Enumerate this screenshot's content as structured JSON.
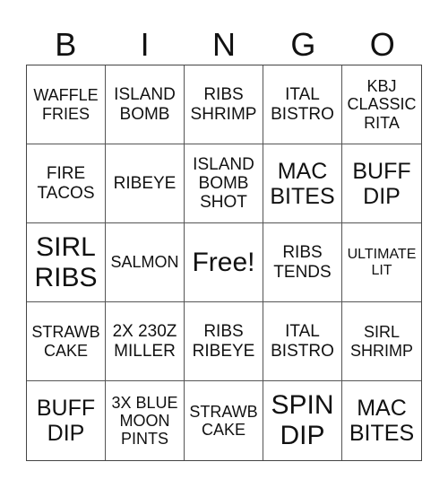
{
  "header": {
    "letters": [
      "B",
      "I",
      "N",
      "G",
      "O"
    ]
  },
  "card": {
    "cells": [
      {
        "text": "WAFFLE FRIES",
        "size": "s17"
      },
      {
        "text": "ISLAND BOMB",
        "size": "s19"
      },
      {
        "text": "RIBS SHRIMP",
        "size": "s19"
      },
      {
        "text": "ITAL BISTRO",
        "size": "s19"
      },
      {
        "text": "KBJ CLASSIC RITA",
        "size": "s17"
      },
      {
        "text": "FIRE TACOS",
        "size": "s19"
      },
      {
        "text": "RIBEYE",
        "size": "s19"
      },
      {
        "text": "ISLAND BOMB SHOT",
        "size": "s19"
      },
      {
        "text": "MAC BITES",
        "size": "s24"
      },
      {
        "text": "BUFF DIP",
        "size": "s24"
      },
      {
        "text": "SIRL RIBS",
        "size": "s29"
      },
      {
        "text": "SALMON",
        "size": "s17"
      },
      {
        "text": "Free!",
        "size": "s29"
      },
      {
        "text": "RIBS TENDS",
        "size": "s19"
      },
      {
        "text": "ULTIMATE LIT",
        "size": "s14"
      },
      {
        "text": "STRAWB CAKE",
        "size": "s17"
      },
      {
        "text": "2X 230Z MILLER",
        "size": "s19"
      },
      {
        "text": "RIBS RIBEYE",
        "size": "s19"
      },
      {
        "text": "ITAL BISTRO",
        "size": "s19"
      },
      {
        "text": "SIRL SHRIMP",
        "size": "s17"
      },
      {
        "text": "BUFF DIP",
        "size": "s24"
      },
      {
        "text": "3X BLUE MOON PINTS",
        "size": "s17"
      },
      {
        "text": "STRAWB CAKE",
        "size": "s17"
      },
      {
        "text": "SPIN DIP",
        "size": "s29"
      },
      {
        "text": "MAC BITES",
        "size": "s24"
      }
    ]
  }
}
